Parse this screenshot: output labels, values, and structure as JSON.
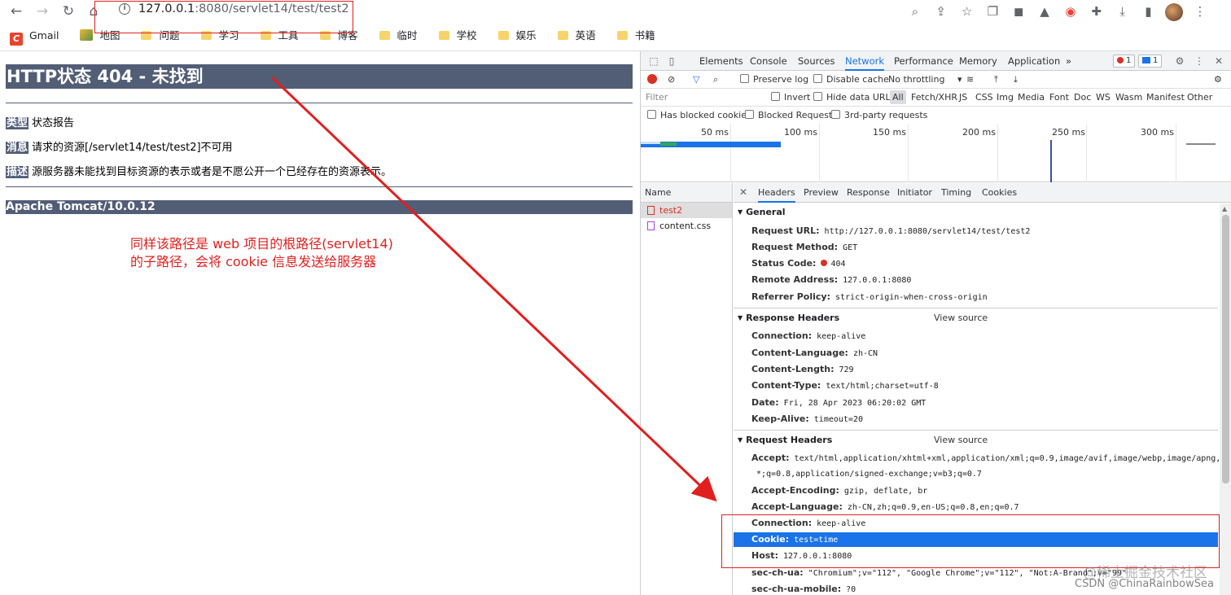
{
  "browser": {
    "url_host": "127.0.0.1",
    "url_rest": ":8080/servlet14/test/test2",
    "bookmarks": [
      {
        "label": "Gmail",
        "icon": "gmail-icon"
      },
      {
        "label": "地图",
        "icon": "map-icon"
      },
      {
        "label": "问题",
        "icon": "folder-icon"
      },
      {
        "label": "学习",
        "icon": "folder-icon"
      },
      {
        "label": "工具",
        "icon": "folder-icon"
      },
      {
        "label": "博客",
        "icon": "folder-icon"
      },
      {
        "label": "临时",
        "icon": "folder-icon"
      },
      {
        "label": "学校",
        "icon": "folder-icon"
      },
      {
        "label": "娱乐",
        "icon": "folder-icon"
      },
      {
        "label": "英语",
        "icon": "folder-icon"
      },
      {
        "label": "书籍",
        "icon": "folder-icon"
      }
    ]
  },
  "page": {
    "h1": "HTTP状态 404 - 未找到",
    "type_label": "类型",
    "type_value": "状态报告",
    "message_label": "消息",
    "message_value": "请求的资源[/servlet14/test/test2]不可用",
    "desc_label": "描述",
    "desc_value": "源服务器未能找到目标资源的表示或者是不愿公开一个已经存在的资源表示。",
    "footer": "Apache Tomcat/10.0.12",
    "note_line1": "同样该路径是 web 项目的根路径(servlet14)",
    "note_line2": "的子路径，会将 cookie 信息发送给服务器"
  },
  "devtools": {
    "tabs": [
      "Elements",
      "Console",
      "Sources",
      "Network",
      "Performance",
      "Memory",
      "Application"
    ],
    "active_tab": "Network",
    "more": "»",
    "error_count": "1",
    "message_count": "1",
    "toolbar": {
      "preserve_log": "Preserve log",
      "disable_cache": "Disable cache",
      "throttling": "No throttling"
    },
    "filter": {
      "placeholder": "Filter",
      "invert": "Invert",
      "hide_data_urls": "Hide data URLs",
      "types": [
        "All",
        "Fetch/XHR",
        "JS",
        "CSS",
        "Img",
        "Media",
        "Font",
        "Doc",
        "WS",
        "Wasm",
        "Manifest",
        "Other"
      ],
      "has_blocked_cookies": "Has blocked cookies",
      "blocked_requests": "Blocked Requests",
      "third_party": "3rd-party requests"
    },
    "timeline_labels": [
      "50 ms",
      "100 ms",
      "150 ms",
      "200 ms",
      "250 ms",
      "300 ms"
    ],
    "name_header": "Name",
    "requests": [
      "test2",
      "content.css"
    ],
    "detail_tabs": [
      "Headers",
      "Preview",
      "Response",
      "Initiator",
      "Timing",
      "Cookies"
    ],
    "general_title": "General",
    "general": [
      {
        "k": "Request URL:",
        "v": "http://127.0.0.1:8080/servlet14/test/test2"
      },
      {
        "k": "Request Method:",
        "v": "GET"
      },
      {
        "k": "Status Code:",
        "v": "404"
      },
      {
        "k": "Remote Address:",
        "v": "127.0.0.1:8080"
      },
      {
        "k": "Referrer Policy:",
        "v": "strict-origin-when-cross-origin"
      }
    ],
    "response_title": "Response Headers",
    "view_source": "View source",
    "response": [
      {
        "k": "Connection:",
        "v": "keep-alive"
      },
      {
        "k": "Content-Language:",
        "v": "zh-CN"
      },
      {
        "k": "Content-Length:",
        "v": "729"
      },
      {
        "k": "Content-Type:",
        "v": "text/html;charset=utf-8"
      },
      {
        "k": "Date:",
        "v": "Fri, 28 Apr 2023 06:20:02 GMT"
      },
      {
        "k": "Keep-Alive:",
        "v": "timeout=20"
      }
    ],
    "request_title": "Request Headers",
    "request": [
      {
        "k": "Accept:",
        "v": "text/html,application/xhtml+xml,application/xml;q=0.9,image/avif,image/webp,image/apng,*/"
      },
      {
        "k": "",
        "v": "*;q=0.8,application/signed-exchange;v=b3;q=0.7"
      },
      {
        "k": "Accept-Encoding:",
        "v": "gzip, deflate, br"
      },
      {
        "k": "Accept-Language:",
        "v": "zh-CN,zh;q=0.9,en-US;q=0.8,en;q=0.7"
      },
      {
        "k": "Connection:",
        "v": "keep-alive"
      },
      {
        "k": "Cookie:",
        "v": "test=time"
      },
      {
        "k": "Host:",
        "v": "127.0.0.1:8080"
      },
      {
        "k": "sec-ch-ua:",
        "v": "\"Chromium\";v=\"112\", \"Google Chrome\";v=\"112\", \"Not:A-Brand\";v=\"99\""
      },
      {
        "k": "sec-ch-ua-mobile:",
        "v": "?0"
      }
    ]
  },
  "watermark": {
    "line1": "@稀土掘金技术社区",
    "line2": "CSDN @ChinaRainbowSea"
  }
}
